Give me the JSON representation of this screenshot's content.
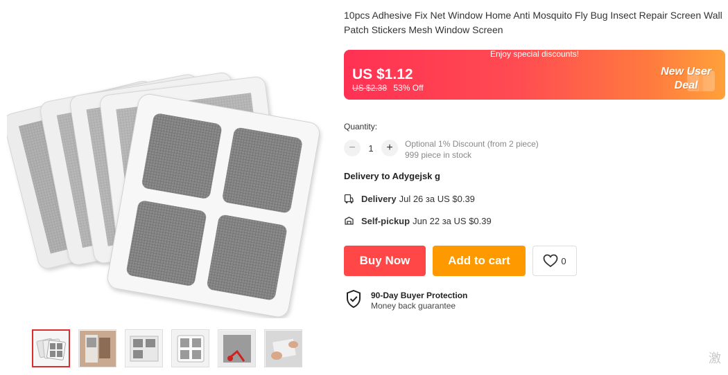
{
  "product": {
    "title": "10pcs Adhesive Fix Net Window Home Anti Mosquito Fly Bug Insect Repair Screen Wall Patch Stickers Mesh Window Screen"
  },
  "price": {
    "banner_top": "Enjoy special discounts!",
    "current": "US $1.12",
    "original": "US $2.38",
    "discount": "53% Off",
    "badge_line1": "New User",
    "badge_line2": "Deal"
  },
  "quantity": {
    "label": "Quantity:",
    "value": "1",
    "minus": "−",
    "plus": "+",
    "discount_note": "Optional 1% Discount (from 2 piece)",
    "stock": "999 piece in stock"
  },
  "delivery": {
    "to": "Delivery to Adygejsk g",
    "options": [
      {
        "label": "Delivery",
        "detail": "Jul 26 за US $0.39",
        "icon": "truck-icon"
      },
      {
        "label": "Self-pickup",
        "detail": "Jun 22 за US $0.39",
        "icon": "pickup-icon"
      }
    ]
  },
  "actions": {
    "buy_now": "Buy Now",
    "add_to_cart": "Add to cart",
    "wishlist_count": "0"
  },
  "protection": {
    "title": "90-Day Buyer Protection",
    "subtitle": "Money back guarantee"
  },
  "watermark": "激",
  "colors": {
    "buy": "#ff4747",
    "cart": "#ff9900",
    "banner_start": "#ff3153",
    "banner_end": "#ffa13a",
    "thumb_active": "#e02b2b"
  }
}
